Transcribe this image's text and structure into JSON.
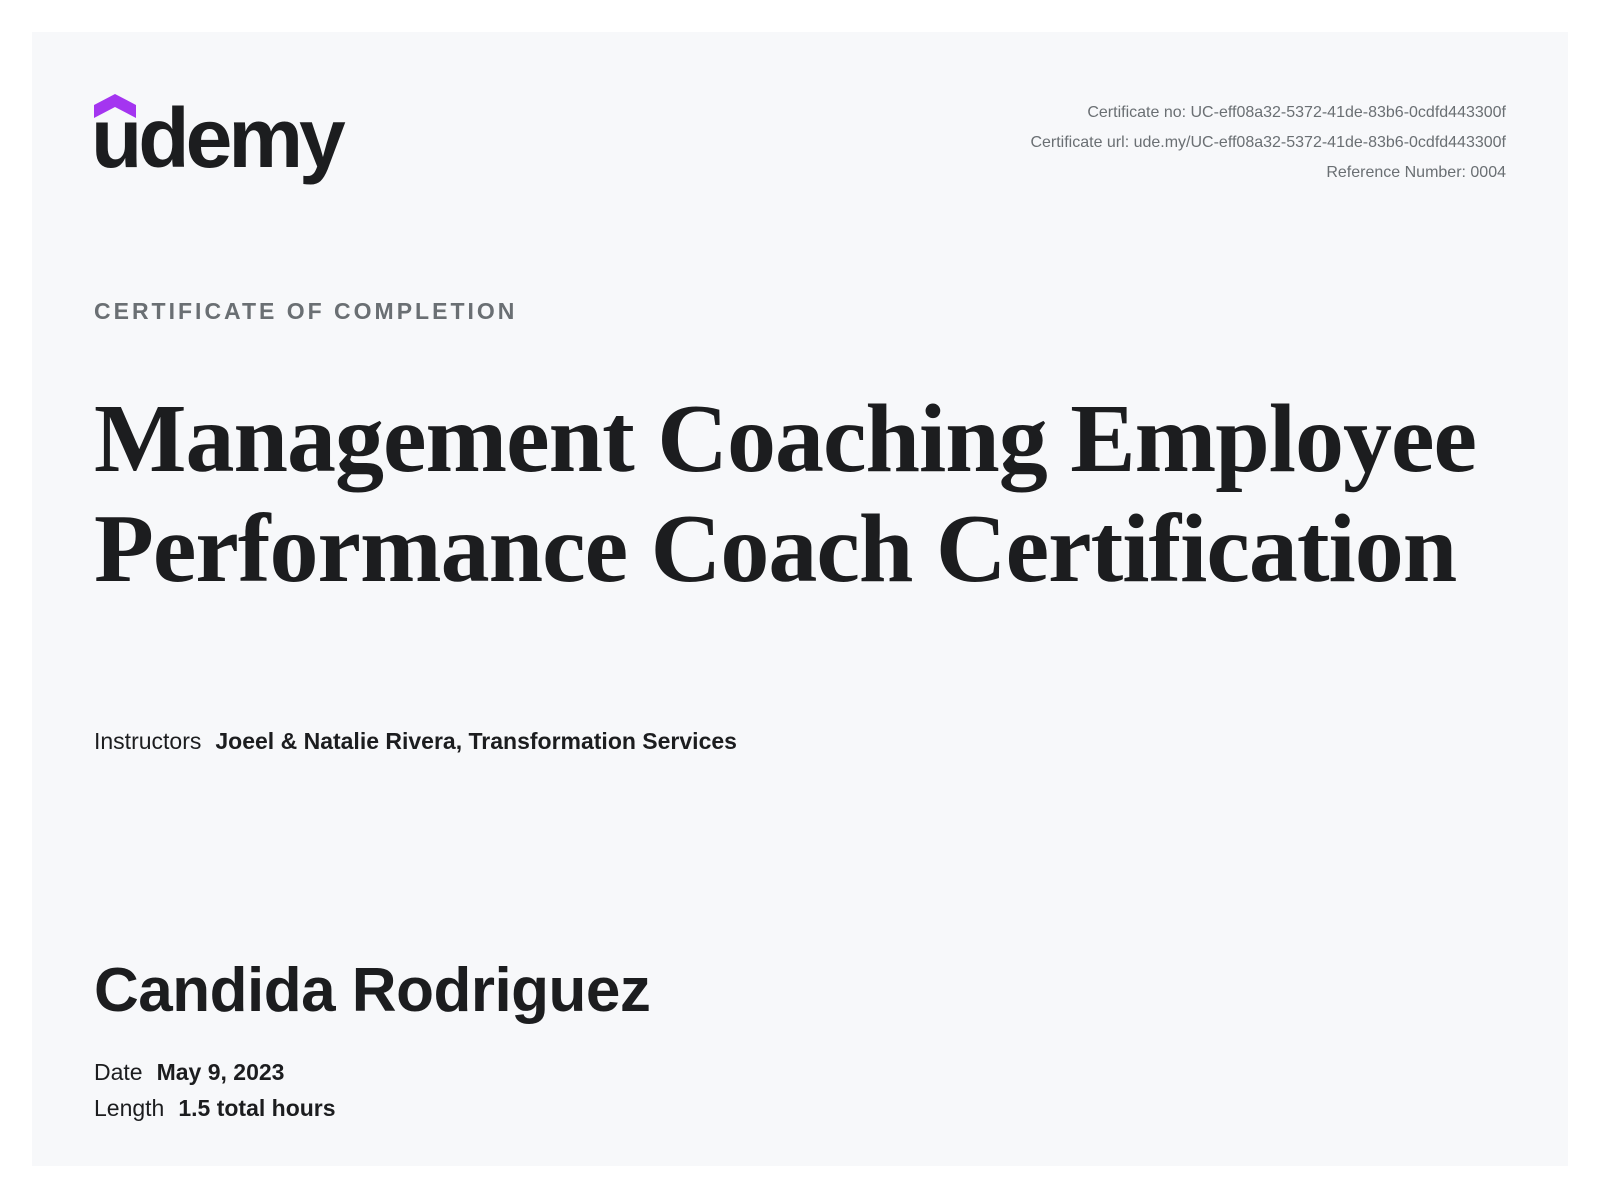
{
  "brand": {
    "logo_text": "udemy",
    "logo_icon": "udemy-hat-icon",
    "accent_color": "#a435f0",
    "text_color": "#1c1d1f",
    "muted_color": "#6a6f73",
    "background_color": "#f7f8fa"
  },
  "meta": {
    "certificate_no": "Certificate no: UC-eff08a32-5372-41de-83b6-0cdfd443300f",
    "certificate_url": "Certificate url: ude.my/UC-eff08a32-5372-41de-83b6-0cdfd443300f",
    "reference_number": "Reference Number: 0004"
  },
  "certificate": {
    "eyebrow": "CERTIFICATE OF COMPLETION",
    "course_title": "Management Coaching Employee Performance Coach Certification",
    "instructors_label": "Instructors",
    "instructors": "Joeel & Natalie Rivera,  Transformation Services",
    "recipient_name": "Candida Rodriguez",
    "date_label": "Date",
    "date_value": "May 9, 2023",
    "length_label": "Length",
    "length_value": "1.5 total hours"
  }
}
